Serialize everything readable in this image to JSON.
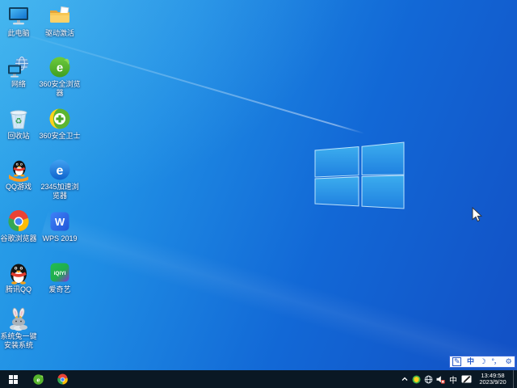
{
  "desktop": {
    "icons": [
      {
        "label": "此电脑"
      },
      {
        "label": "驱动激活"
      },
      {
        "label": "网络"
      },
      {
        "label": "360安全浏览器"
      },
      {
        "label": "回收站"
      },
      {
        "label": "360安全卫士"
      },
      {
        "label": "QQ游戏"
      },
      {
        "label": "2345加速浏览器"
      },
      {
        "label": "谷歌浏览器"
      },
      {
        "label": "WPS 2019"
      },
      {
        "label": "腾讯QQ"
      },
      {
        "label": "爱奇艺"
      },
      {
        "label": "系统兔一键安装系统"
      }
    ],
    "iqiyi_icon_text": "iQIYI",
    "wps_icon_letter": "W",
    "browser_e_letter": "e"
  },
  "taskbar": {
    "tray": {
      "ime_mode": "中",
      "time": "13:49:58",
      "date": "2023/9/20"
    }
  },
  "ime_bar": {
    "mode_chinese": "中",
    "punctuation": "°，"
  },
  "glyphs": {
    "recycle": "♻",
    "moon": "☽",
    "pen": "✎",
    "gear": "⚙"
  },
  "colors": {
    "wallpaper_light": "#2fa9ea",
    "wallpaper_dark": "#0f52c8",
    "taskbar": "#0a1824",
    "ime_accent": "#2458c8"
  }
}
